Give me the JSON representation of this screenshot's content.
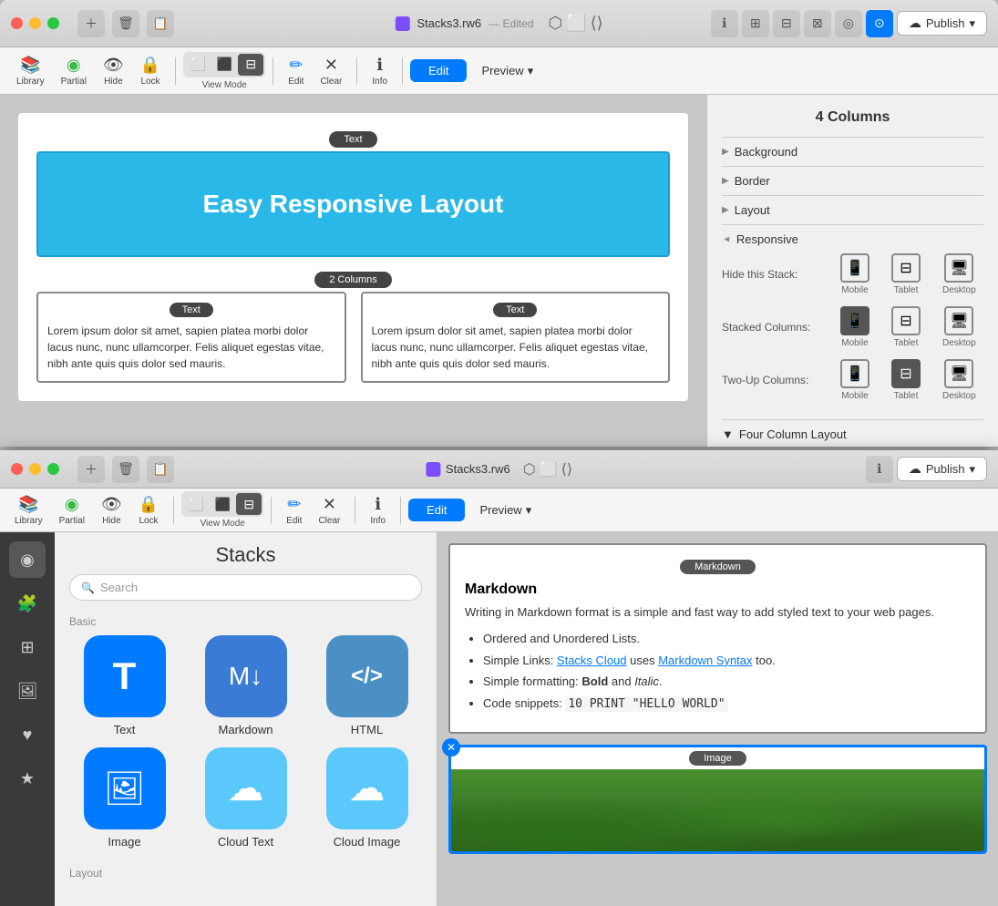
{
  "window_top": {
    "title": "Stacks3.rw6",
    "edited": "— Edited",
    "tab_edit": "Edit",
    "tab_preview": "Preview",
    "toolbar": {
      "library": "Library",
      "partial": "Partial",
      "hide": "Hide",
      "lock": "Lock",
      "view_mode": "View Mode",
      "edit": "Edit",
      "clear": "Clear",
      "info": "Info"
    },
    "publish": "Publish",
    "hero_text": "Easy Responsive Layout",
    "text_label": "Text",
    "two_col_label": "2 Columns",
    "col1_text": "Lorem ipsum dolor sit amet, sapien platea morbi dolor lacus nunc, nunc ullamcorper. Felis aliquet egestas vitae, nibh ante quis quis dolor sed mauris.",
    "col2_text": "Lorem ipsum dolor sit amet, sapien platea morbi dolor lacus nunc, nunc ullamcorper. Felis aliquet egestas vitae, nibh ante quis quis dolor sed mauris.",
    "panel": {
      "title": "4 Columns",
      "background": "Background",
      "border": "Border",
      "layout": "Layout",
      "responsive": "Responsive",
      "hide_stack": "Hide this Stack:",
      "stacked_columns": "Stacked Columns:",
      "two_up_columns": "Two-Up Columns:",
      "mobile": "Mobile",
      "tablet": "Tablet",
      "desktop": "Desktop",
      "four_col_layout": "Four Column Layout"
    }
  },
  "window_bottom": {
    "title": "Stacks3.rw6",
    "tab_edit": "Edit",
    "tab_preview": "Preview",
    "toolbar": {
      "library": "Library",
      "partial": "Partial",
      "hide": "Hide",
      "lock": "Lock",
      "view_mode": "View Mode",
      "edit": "Edit",
      "clear": "Clear",
      "info": "Info"
    },
    "publish": "Publish",
    "stacks_title": "Stacks",
    "search_placeholder": "Search",
    "clear_btn": "Clear",
    "basic_label": "Basic",
    "layout_label": "Layout",
    "stacks": [
      {
        "name": "Text",
        "color": "blue",
        "icon": "T"
      },
      {
        "name": "Markdown",
        "color": "blue-md",
        "icon": "M↓"
      },
      {
        "name": "HTML",
        "color": "blue-html",
        "icon": "</>"
      },
      {
        "name": "Image",
        "color": "blue",
        "icon": "🖼"
      },
      {
        "name": "Cloud Text",
        "color": "teal",
        "icon": "☁"
      },
      {
        "name": "Cloud Image",
        "color": "teal",
        "icon": "☁"
      }
    ],
    "markdown": {
      "label": "Markdown",
      "title": "Markdown",
      "intro": "Writing in Markdown format is a simple and fast way to add styled text to your web pages.",
      "items": [
        "Ordered and Unordered Lists.",
        "Simple Links: Stacks Cloud uses Markdown Syntax too.",
        "Simple formatting: Bold and Italic.",
        "Code snippets: 10 PRINT \"HELLO WORLD\""
      ]
    },
    "image_label": "Image"
  }
}
